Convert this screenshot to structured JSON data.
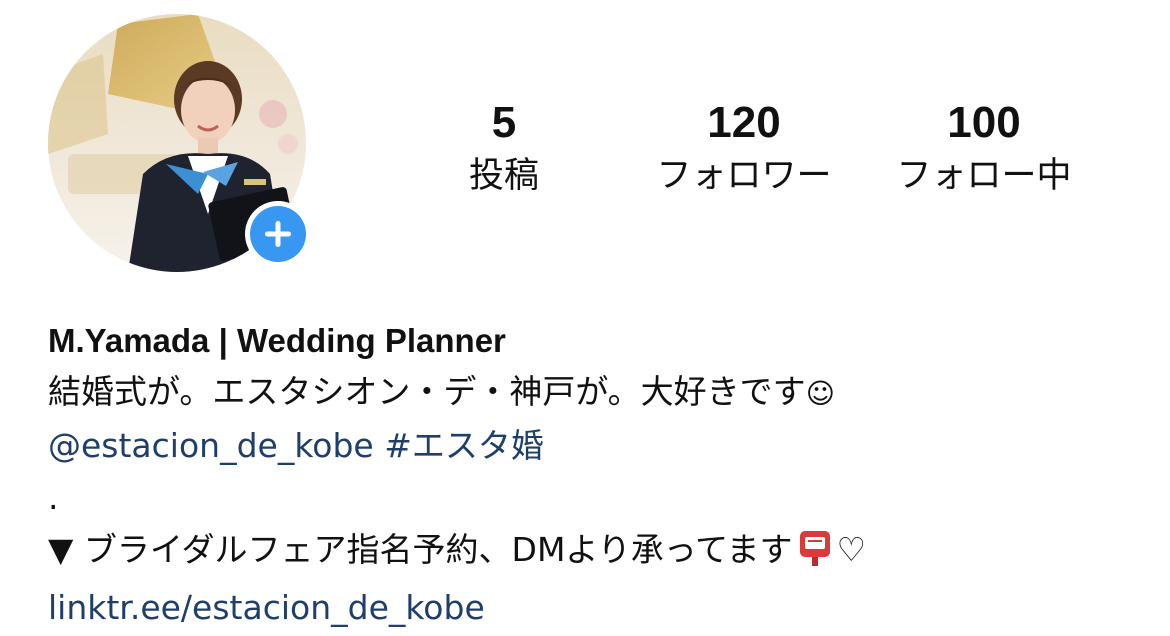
{
  "profile": {
    "stats": [
      {
        "value": "5",
        "label": "投稿"
      },
      {
        "value": "120",
        "label": "フォロワー"
      },
      {
        "value": "100",
        "label": "フォロー中"
      }
    ],
    "name": "M.Yamada | Wedding Planner",
    "bio": {
      "line1": "結婚式が。エスタシオン・デ・神戸が。大好きです",
      "line1_emoji": "☺",
      "mention": "@estacion_de_kobe",
      "hashtag": "#エスタ婚",
      "dot": ".",
      "line3": "▼ ブライダルフェア指名予約、DMより承ってます",
      "heart": "♡",
      "link": "linktr.ee/estacion_de_kobe"
    }
  },
  "colors": {
    "accent": "#3897f0",
    "link": "#1f3f6b",
    "text": "#111111"
  },
  "icons": {
    "add_story": "plus-icon",
    "mailbox": "postbox-icon",
    "heart": "heart-icon"
  }
}
